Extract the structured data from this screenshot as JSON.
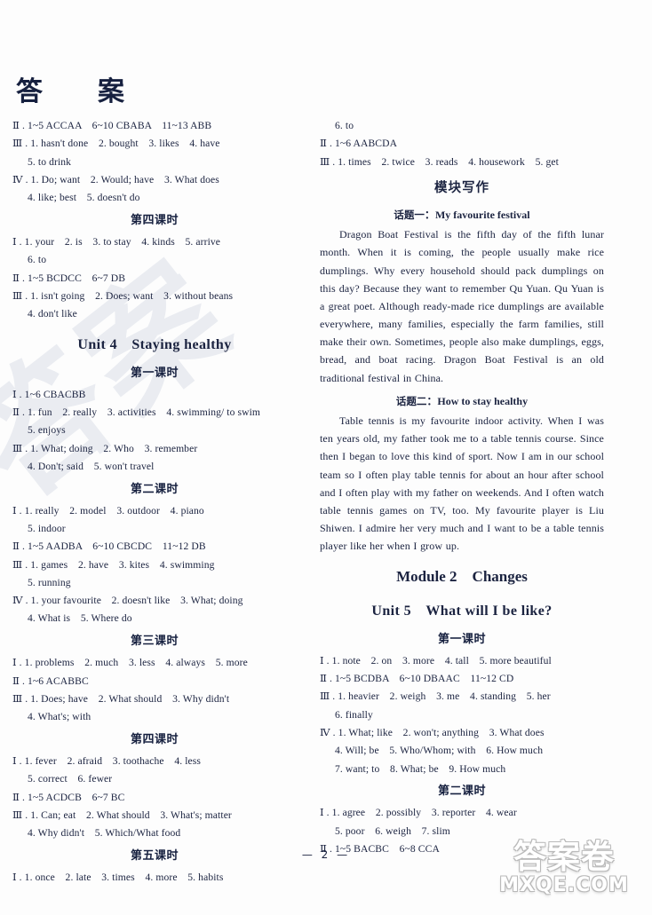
{
  "document": {
    "title": "答　案",
    "page_number": "— 2 —"
  },
  "watermark": {
    "background_text": "答案",
    "logo_cn": "答案卷",
    "logo_domain": "MXQE.COM"
  },
  "left_column": {
    "blocks": [
      {
        "type": "line",
        "text": "Ⅱ . 1~5 ACCAA　6~10 CBABA　11~13 ABB"
      },
      {
        "type": "line",
        "text": "Ⅲ . 1. hasn't done　2. bought　3. likes　4. have"
      },
      {
        "type": "line",
        "indent": true,
        "text": "5. to drink"
      },
      {
        "type": "line",
        "text": "Ⅳ . 1. Do; want　2. Would; have　3. What does"
      },
      {
        "type": "line",
        "indent": true,
        "text": "4. like; best　5. doesn't do"
      },
      {
        "type": "period",
        "text": "第四课时"
      },
      {
        "type": "line",
        "text": "Ⅰ . 1. your　2. is　3. to stay　4. kinds　5. arrive"
      },
      {
        "type": "line",
        "indent": true,
        "text": "6. to"
      },
      {
        "type": "line",
        "text": "Ⅱ . 1~5 BCDCC　6~7 DB"
      },
      {
        "type": "line",
        "text": "Ⅲ . 1. isn't going　2. Does; want　3. without beans"
      },
      {
        "type": "line",
        "indent": true,
        "text": "4. don't like"
      },
      {
        "type": "unit",
        "text": "Unit 4　Staying healthy"
      },
      {
        "type": "period",
        "text": "第一课时"
      },
      {
        "type": "line",
        "text": "Ⅰ . 1~6 CBACBB"
      },
      {
        "type": "line",
        "text": "Ⅱ . 1. fun　2. really　3. activities　4. swimming/ to swim"
      },
      {
        "type": "line",
        "indent": true,
        "text": "5. enjoys"
      },
      {
        "type": "line",
        "text": "Ⅲ . 1. What; doing　2. Who　3. remember"
      },
      {
        "type": "line",
        "indent": true,
        "text": "4. Don't; said　5. won't travel"
      },
      {
        "type": "period",
        "text": "第二课时"
      },
      {
        "type": "line",
        "text": "Ⅰ . 1. really　2. model　3. outdoor　4. piano"
      },
      {
        "type": "line",
        "indent": true,
        "text": "5. indoor"
      },
      {
        "type": "line",
        "text": "Ⅱ . 1~5 AADBA　6~10 CBCDC　11~12 DB"
      },
      {
        "type": "line",
        "text": "Ⅲ . 1. games　2. have　3. kites　4. swimming"
      },
      {
        "type": "line",
        "indent": true,
        "text": "5. running"
      },
      {
        "type": "line",
        "text": "Ⅳ . 1. your favourite　2. doesn't like　3. What; doing"
      },
      {
        "type": "line",
        "indent": true,
        "text": "4. What is　5. Where do"
      },
      {
        "type": "period",
        "text": "第三课时"
      },
      {
        "type": "line",
        "text": "Ⅰ . 1. problems　2. much　3. less　4. always　5. more"
      },
      {
        "type": "line",
        "text": "Ⅱ . 1~6 ACABBC"
      },
      {
        "type": "line",
        "text": "Ⅲ . 1. Does; have　2. What should　3. Why didn't"
      },
      {
        "type": "line",
        "indent": true,
        "text": "4. What's; with"
      },
      {
        "type": "period",
        "text": "第四课时"
      },
      {
        "type": "line",
        "text": "Ⅰ . 1. fever　2. afraid　3. toothache　4. less"
      },
      {
        "type": "line",
        "indent": true,
        "text": "5. correct　6. fewer"
      },
      {
        "type": "line",
        "text": "Ⅱ . 1~5 ACDCB　6~7 BC"
      },
      {
        "type": "line",
        "text": "Ⅲ . 1. Can; eat　2. What should　3. What's; matter"
      },
      {
        "type": "line",
        "indent": true,
        "text": "4. Why didn't　5. Which/What food"
      },
      {
        "type": "period",
        "text": "第五课时"
      },
      {
        "type": "line",
        "text": "Ⅰ . 1. once　2. late　3. times　4. more　5. habits"
      }
    ]
  },
  "right_column": {
    "blocks": [
      {
        "type": "line",
        "indent": true,
        "text": "6. to"
      },
      {
        "type": "line",
        "text": "Ⅱ . 1~6 AABCDA"
      },
      {
        "type": "line",
        "text": "Ⅲ . 1. times　2. twice　3. reads　4. housework　5. get"
      },
      {
        "type": "section",
        "text": "模块写作"
      },
      {
        "type": "topic",
        "cn": "话题一",
        "sep": "：",
        "en": "My favourite festival"
      },
      {
        "type": "para",
        "text": "Dragon Boat Festival is the fifth day of the fifth lunar month. When it is coming, the people usually make rice dumplings. Why every household should pack dumplings on this day? Because they want to remember Qu Yuan. Qu Yuan is a great poet. Although ready-made rice dumplings are available everywhere, many families, especially the farm families, still make their own. Sometimes, people also make dumplings, eggs, bread, and boat racing. Dragon Boat Festival is an old traditional festival in China."
      },
      {
        "type": "topic",
        "cn": "话题二",
        "sep": "：",
        "en": "How to stay healthy"
      },
      {
        "type": "para",
        "text": "Table tennis is my favourite indoor activity. When I was ten years old, my father took me to a table tennis course. Since then I began to love this kind of sport. Now I am in our school team so I often play table tennis for about an hour after school and I often play with my father on weekends. And I often watch table tennis games on TV, too. My favourite player is Liu Shiwen. I admire her very much and I want to be a table tennis player like her when I grow up."
      },
      {
        "type": "module",
        "text": "Module 2　Changes"
      },
      {
        "type": "unit",
        "text": "Unit 5　What will I be like?"
      },
      {
        "type": "period",
        "text": "第一课时"
      },
      {
        "type": "line",
        "text": "Ⅰ . 1. note　2. on　3. more　4. tall　5. more beautiful"
      },
      {
        "type": "line",
        "text": "Ⅱ . 1~5 BCDBA　6~10 DBAAC　11~12 CD"
      },
      {
        "type": "line",
        "text": "Ⅲ . 1. heavier　2. weigh　3. me　4. standing　5. her"
      },
      {
        "type": "line",
        "indent": true,
        "text": "6. finally"
      },
      {
        "type": "line",
        "text": "Ⅳ . 1. What; like　2. won't; anything　3. What does"
      },
      {
        "type": "line",
        "indent": true,
        "text": "4. Will; be　5. Who/Whom; with　6. How much"
      },
      {
        "type": "line",
        "indent": true,
        "text": "7. want; to　8. What; be　9. How much"
      },
      {
        "type": "period",
        "text": "第二课时"
      },
      {
        "type": "line",
        "text": "Ⅰ . 1. agree　2. possibly　3. reporter　4. wear"
      },
      {
        "type": "line",
        "indent": true,
        "text": "5. poor　6. weigh　7. slim"
      },
      {
        "type": "line",
        "text": "Ⅱ . 1~5 BACBC　6~8 CCA"
      }
    ]
  }
}
